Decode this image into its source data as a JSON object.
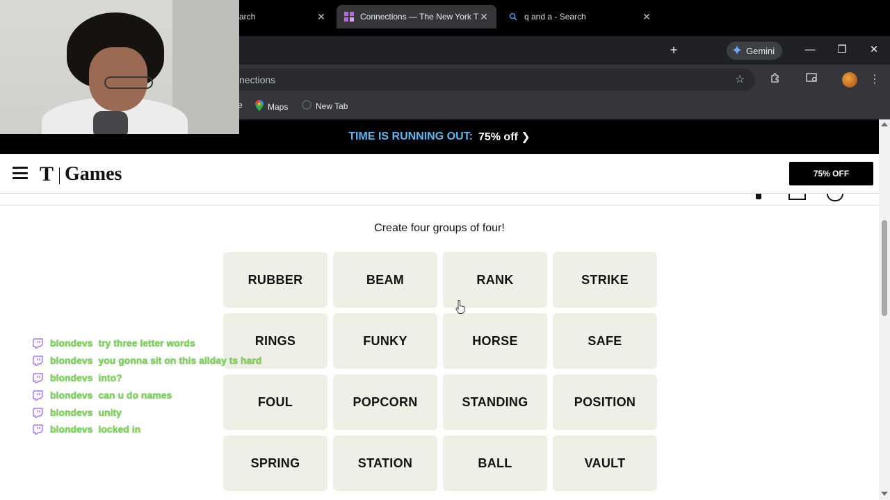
{
  "browser": {
    "tabs": [
      {
        "label": "arch",
        "active": false
      },
      {
        "label": "Connections — The New York T",
        "active": true
      },
      {
        "label": "q and a - Search",
        "active": false
      }
    ],
    "new_tab_symbol": "+",
    "gemini_label": "Gemini",
    "omnibox_text": "nections",
    "bookmarks": [
      {
        "label": "e",
        "icon": "partial-bookmark"
      },
      {
        "label": "Maps",
        "icon": "maps-icon"
      },
      {
        "label": "New Tab",
        "icon": "new-tab-favicon"
      }
    ],
    "window_controls": {
      "minimize": "—",
      "restore": "❐",
      "close": "✕"
    }
  },
  "promo": {
    "highlight": "TIME IS RUNNING OUT:",
    "offer": "75% off ❯"
  },
  "header": {
    "logo_t": "T",
    "logo_games": "Games",
    "offer_button": "75% OFF"
  },
  "game": {
    "prompt": "Create four groups of four!",
    "tiles": [
      [
        "RUBBER",
        "BEAM",
        "RANK",
        "STRIKE"
      ],
      [
        "RINGS",
        "FUNKY",
        "HORSE",
        "SAFE"
      ],
      [
        "FOUL",
        "POPCORN",
        "STANDING",
        "POSITION"
      ],
      [
        "SPRING",
        "STATION",
        "BALL",
        "VAULT"
      ]
    ]
  },
  "chat": {
    "messages": [
      {
        "user": "blondevs",
        "text": "try three letter words"
      },
      {
        "user": "blondevs",
        "text": "you gonna sit on this allday ts hard"
      },
      {
        "user": "blondevs",
        "text": "into?"
      },
      {
        "user": "blondevs",
        "text": "can u do names"
      },
      {
        "user": "blondevs",
        "text": "unity"
      },
      {
        "user": "blondevs",
        "text": "locked in"
      }
    ]
  },
  "colors": {
    "tile_bg": "#efefe6",
    "promo_accent": "#5bb8f5",
    "chat_text": "#7ed957",
    "twitch_purple": "#a970ff"
  }
}
